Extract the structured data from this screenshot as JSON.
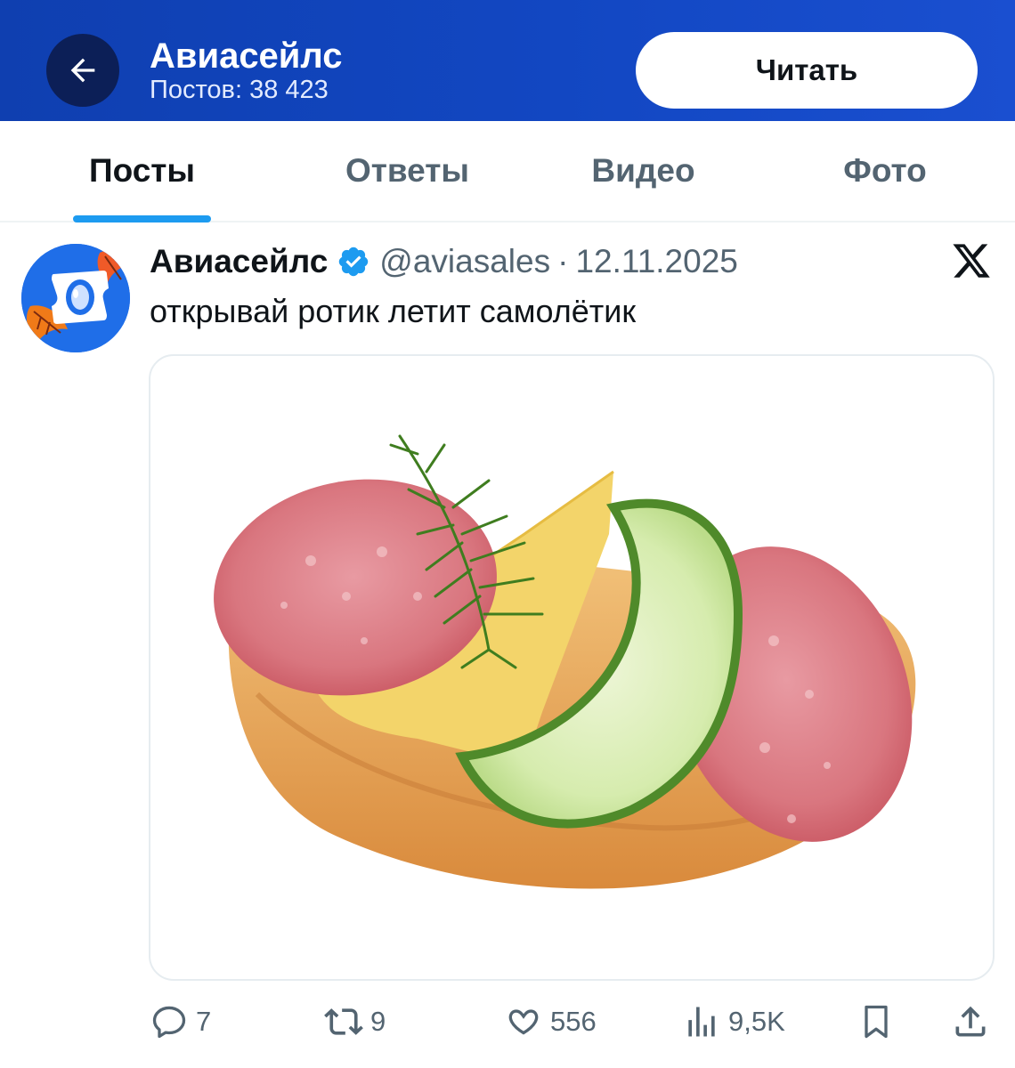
{
  "header": {
    "title": "Авиасейлс",
    "subtitle": "Постов: 38 423",
    "follow_label": "Читать",
    "back_icon": "arrow-left-icon"
  },
  "tabs": [
    {
      "label": "Посты",
      "active": true
    },
    {
      "label": "Ответы",
      "active": false
    },
    {
      "label": "Видео",
      "active": false
    },
    {
      "label": "Фото",
      "active": false
    }
  ],
  "post": {
    "author": "Авиасейлс",
    "verified": true,
    "handle": "@aviasales",
    "separator": "·",
    "date": "12.11.2025",
    "text": "открывай ротик летит самолётик",
    "platform_icon": "x-logo-icon",
    "media_icon": "sandwich-image"
  },
  "actions": {
    "replies": "7",
    "reposts": "9",
    "likes": "556",
    "views": "9,5K"
  },
  "colors": {
    "header_bg": "#1247c2",
    "accent": "#1d9bf0",
    "text": "#0f1419",
    "muted": "#536471"
  }
}
